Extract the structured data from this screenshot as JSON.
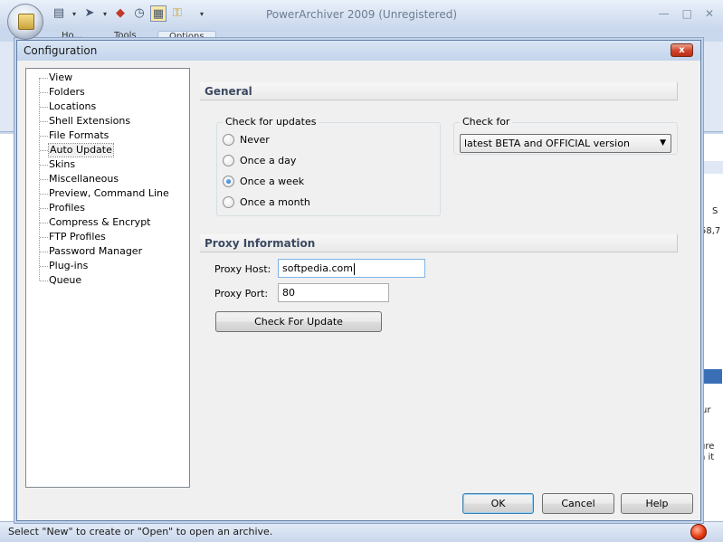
{
  "app": {
    "title": "PowerArchiver 2009 (Unregistered)",
    "ribbon_tabs": [
      {
        "label": "Ho..."
      },
      {
        "label": "Tools"
      },
      {
        "label": "Options"
      }
    ],
    "status_text": "Select \"New\" to create or \"Open\" to open an archive.",
    "right_panel_snippets": [
      "S",
      "58,7",
      "ur",
      "ure",
      "n it"
    ]
  },
  "quick_access": [
    {
      "icon": "new-archive-icon"
    },
    {
      "icon": "open-archive-icon"
    },
    {
      "icon": "cube-icon"
    },
    {
      "icon": "clock-icon"
    },
    {
      "icon": "calendar-icon"
    },
    {
      "icon": "key-icon"
    }
  ],
  "dialog": {
    "title": "Configuration",
    "close_label": "x",
    "nav_items": [
      {
        "label": "View"
      },
      {
        "label": "Folders"
      },
      {
        "label": "Locations"
      },
      {
        "label": "Shell Extensions"
      },
      {
        "label": "File Formats"
      },
      {
        "label": "Auto Update",
        "selected": true
      },
      {
        "label": "Skins"
      },
      {
        "label": "Miscellaneous"
      },
      {
        "label": "Preview, Command Line"
      },
      {
        "label": "Profiles"
      },
      {
        "label": "Compress & Encrypt"
      },
      {
        "label": "FTP Profiles"
      },
      {
        "label": "Password Manager"
      },
      {
        "label": "Plug-ins"
      },
      {
        "label": "Queue"
      }
    ],
    "general": {
      "header": "General",
      "check_for_updates": {
        "legend": "Check for updates",
        "options": [
          {
            "label": "Never",
            "checked": false
          },
          {
            "label": "Once a day",
            "checked": false
          },
          {
            "label": "Once a week",
            "checked": true
          },
          {
            "label": "Once a month",
            "checked": false
          }
        ]
      },
      "check_for": {
        "legend": "Check for",
        "selected": "latest BETA and OFFICIAL version"
      }
    },
    "proxy": {
      "header": "Proxy Information",
      "host_label": "Proxy Host:",
      "host_value": "softpedia.com",
      "port_label": "Proxy Port:",
      "port_value": "80",
      "check_button": "Check For Update"
    },
    "buttons": {
      "ok": "OK",
      "cancel": "Cancel",
      "help": "Help"
    }
  }
}
